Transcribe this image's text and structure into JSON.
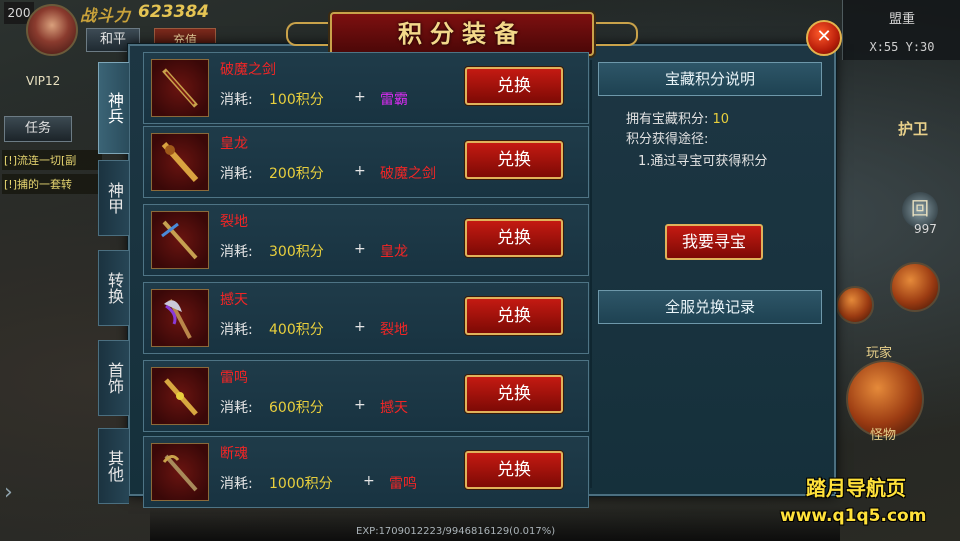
{
  "hud": {
    "level": "200",
    "power_label": "战斗力",
    "power_value": "623384",
    "mode_peace": "和平",
    "mode_recharge": "充值",
    "vip": "VIP12",
    "task_button": "任务",
    "quest_lines": [
      "[!]流连一切[副",
      "[!]捕的一套转"
    ],
    "map_name": "盟重",
    "coordinates": "X:55 Y:30",
    "guard_label": "护卫",
    "count_value": "997",
    "player_label": "玩家",
    "monster_label": "怪物",
    "exp_text": "EXP:1709012223/9946816129(0.017%)"
  },
  "panel": {
    "title": "积分装备",
    "close_icon": "close-icon",
    "tabs": [
      {
        "label": "神兵",
        "active": true
      },
      {
        "label": "神甲",
        "active": false
      },
      {
        "label": "转换",
        "active": false
      },
      {
        "label": "首饰",
        "active": false
      },
      {
        "label": "其他",
        "active": false
      }
    ],
    "cost_label": "消耗:",
    "plus": "+",
    "exchange_label": "兑换",
    "items": [
      {
        "name": "破魔之剑",
        "cost": "100积分",
        "requires": "雷霸",
        "req_color": "#d62cf0"
      },
      {
        "name": "皇龙",
        "cost": "200积分",
        "requires": "破魔之剑",
        "req_color": "#f22525"
      },
      {
        "name": "裂地",
        "cost": "300积分",
        "requires": "皇龙",
        "req_color": "#f22525"
      },
      {
        "name": "撼天",
        "cost": "400积分",
        "requires": "裂地",
        "req_color": "#f22525"
      },
      {
        "name": "雷鸣",
        "cost": "600积分",
        "requires": "撼天",
        "req_color": "#f22525"
      },
      {
        "name": "断魂",
        "cost": "1000积分",
        "requires": "雷鸣",
        "req_color": "#f22525"
      }
    ],
    "info": {
      "header": "宝藏积分说明",
      "points_label": "拥有宝藏积分:",
      "points_value": "10",
      "ways_label": "积分获得途径:",
      "way_1": "1.通过寻宝可获得积分",
      "seek_button": "我要寻宝",
      "record_header": "全服兑换记录"
    }
  },
  "watermark": {
    "title": "踏月导航页",
    "url": "www.q1q5.com"
  },
  "colors": {
    "panel_bg": "#1d3643",
    "button_red": "#c41a12",
    "gold": "#e8cf3d",
    "item_name_red": "#f22525"
  }
}
